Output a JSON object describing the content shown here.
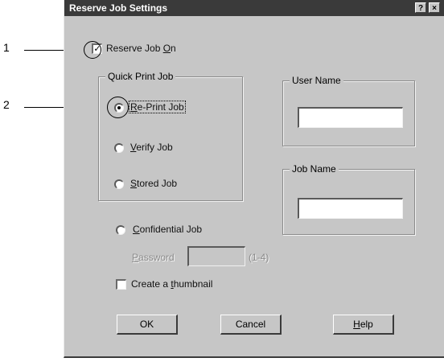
{
  "dialog": {
    "title": "Reserve Job Settings",
    "help_button": "?",
    "close_button": "×"
  },
  "reserve_job_on": {
    "label_prefix": "Reserve Job ",
    "label_ul": "O",
    "label_suffix": "n",
    "checked": true
  },
  "quick_print_group": {
    "title": "Quick Print Job",
    "options": [
      {
        "label_ul": "R",
        "label_rest": "e-Print Job",
        "checked": true
      },
      {
        "label_ul": "V",
        "label_rest": "erify Job",
        "checked": false
      },
      {
        "label_ul": "S",
        "label_rest": "tored Job",
        "checked": false
      }
    ]
  },
  "user_name_group": {
    "title": "User Name",
    "value": ""
  },
  "job_name_group": {
    "title": "Job Name",
    "value": ""
  },
  "confidential": {
    "label_ul": "C",
    "label_rest": "onfidential Job",
    "checked": false
  },
  "password": {
    "label_ul": "P",
    "label_rest": "assword",
    "value": "",
    "hint": "(1-4)"
  },
  "thumbnail": {
    "label_prefix": "Create a ",
    "label_ul": "t",
    "label_rest": "humbnail",
    "checked": false
  },
  "buttons": {
    "ok": "OK",
    "cancel": "Cancel",
    "help_ul": "H",
    "help_rest": "elp"
  },
  "callouts": [
    "1",
    "2"
  ]
}
